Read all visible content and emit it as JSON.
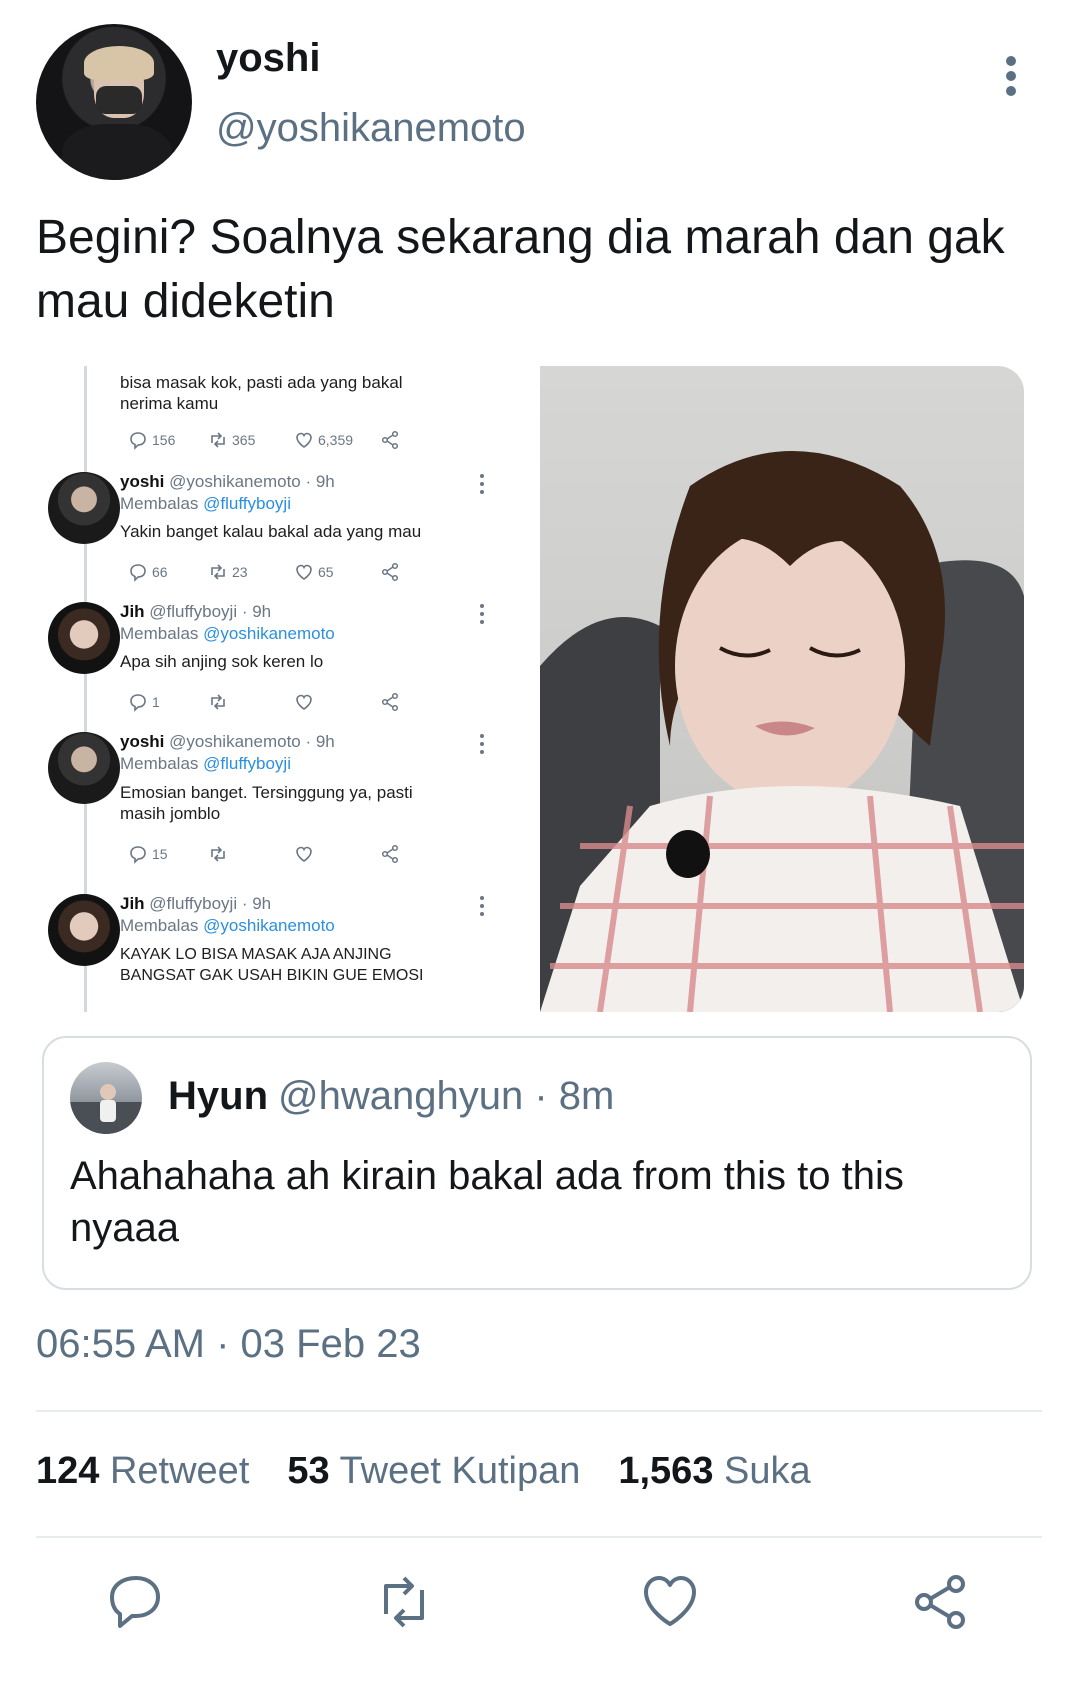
{
  "tweet": {
    "display_name": "yoshi",
    "handle": "@yoshikanemoto",
    "text": "Begini? Soalnya sekarang dia marah dan gak mau dideketin",
    "timestamp": "06:55 AM · 03 Feb 23"
  },
  "screenshot": {
    "top_reply_text": "bisa masak kok, pasti ada yang bakal nerima kamu",
    "top_counts": {
      "replies": "156",
      "retweets": "365",
      "likes": "6,359"
    },
    "replies": [
      {
        "name": "yoshi",
        "handle_time": "@yoshikanemoto · 9h",
        "replying_label": "Membalas",
        "replying_to": "@fluffyboyji",
        "text": "Yakin banget kalau bakal ada yang mau",
        "counts": {
          "replies": "66",
          "retweets": "23",
          "likes": "65"
        }
      },
      {
        "name": "Jih",
        "handle_time": "@fluffyboyji · 9h",
        "replying_label": "Membalas",
        "replying_to": "@yoshikanemoto",
        "text": "Apa sih anjing sok keren lo",
        "counts": {
          "replies": "1",
          "retweets": "",
          "likes": ""
        }
      },
      {
        "name": "yoshi",
        "handle_time": "@yoshikanemoto · 9h",
        "replying_label": "Membalas",
        "replying_to": "@fluffyboyji",
        "text": "Emosian banget. Tersinggung ya, pasti masih jomblo",
        "counts": {
          "replies": "15",
          "retweets": "",
          "likes": ""
        }
      },
      {
        "name": "Jih",
        "handle_time": "@fluffyboyji · 9h",
        "replying_label": "Membalas",
        "replying_to": "@yoshikanemoto",
        "text": "KAYAK LO BISA MASAK AJA ANJING BANGSAT GAK USAH BIKIN GUE EMOSI",
        "counts": {
          "replies": "",
          "retweets": "",
          "likes": ""
        }
      }
    ]
  },
  "quoted": {
    "name": "Hyun",
    "handle_time": "@hwanghyun · 8m",
    "text": "Ahahahaha ah kirain bakal ada from this to this nyaaa"
  },
  "stats": [
    {
      "count": "124",
      "label": "Retweet"
    },
    {
      "count": "53",
      "label": "Tweet Kutipan"
    },
    {
      "count": "1,563",
      "label": "Suka"
    }
  ],
  "actions": [
    "reply-icon",
    "retweet-icon",
    "like-icon",
    "share-icon"
  ],
  "colors": {
    "text": "#14171a",
    "secondary": "#5b7083",
    "link": "#2b8fe0",
    "divider": "#e6ecf0"
  }
}
